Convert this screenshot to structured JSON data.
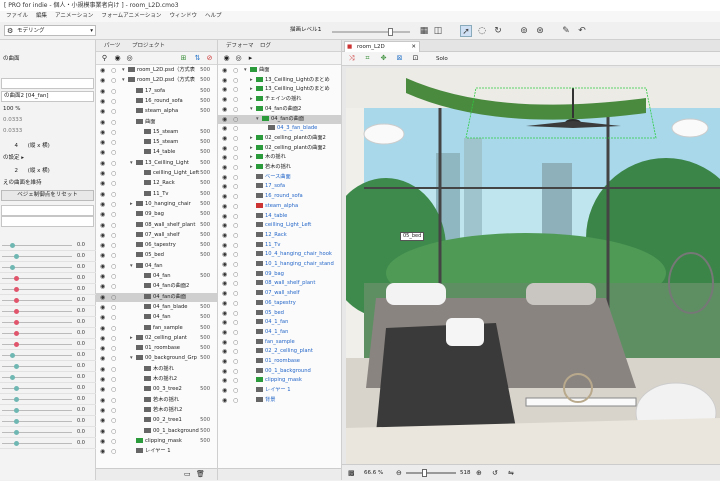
{
  "window": {
    "title": "[ PRO for indie - 個人・小規模事業者向け ] - room_L2D.cmo3"
  },
  "menu": [
    "ファイル",
    "編集",
    "アニメーション",
    "フォームアニメーション",
    "ウィンドウ",
    "ヘルプ"
  ],
  "toolbar": {
    "mode": "モデリング",
    "display_level_label": "描画レベル：",
    "display_level_value": "1"
  },
  "left_panel": {
    "title": "の曲面",
    "part_field": "の曲面2 [04_fan]",
    "opacity": "100 %",
    "val_a": "0.0333",
    "val_b": "0.0333",
    "row_count1": "4",
    "row_count1_suffix": "(縦 x 横)",
    "deform_label": "の設定 ▸",
    "row_count2": "2",
    "row_count2_suffix": "(縦 x 横)",
    "keep_label": "えの曲面を維持",
    "reset_button": "ベジェ制御点をリセット",
    "param_values": [
      "0.0",
      "0.0",
      "0.0",
      "0.0",
      "0.0",
      "0.0",
      "0.0",
      "0.0",
      "0.0",
      "0.0",
      "0.0",
      "0.0",
      "0.0",
      "0.0",
      "0.0",
      "0.0",
      "0.0",
      "0.0",
      "0.0"
    ]
  },
  "parts_panel": {
    "tabs": [
      "パーツ",
      "プロジェクト"
    ],
    "rows": [
      {
        "label": "room_L2D.psd（方式表",
        "num": "500",
        "indent": 0,
        "fold": "▾"
      },
      {
        "label": "room_L2D.psd（方式表",
        "num": "500",
        "indent": 0,
        "fold": "▾"
      },
      {
        "label": "17_sofa",
        "num": "500",
        "indent": 1,
        "fold": ""
      },
      {
        "label": "16_round_sofa",
        "num": "500",
        "indent": 1,
        "fold": ""
      },
      {
        "label": "steam_alpha",
        "num": "500",
        "indent": 1,
        "fold": ""
      },
      {
        "label": "曲面",
        "num": "",
        "indent": 1,
        "fold": ""
      },
      {
        "label": "15_steam",
        "num": "500",
        "indent": 2,
        "fold": ""
      },
      {
        "label": "15_steam",
        "num": "500",
        "indent": 2,
        "fold": ""
      },
      {
        "label": "14_table",
        "num": "500",
        "indent": 2,
        "fold": ""
      },
      {
        "label": "13_Ceilling_Light",
        "num": "500",
        "indent": 1,
        "fold": "▾"
      },
      {
        "label": "ceilling_Light_Left",
        "num": "500",
        "indent": 2,
        "fold": ""
      },
      {
        "label": "12_Rack",
        "num": "500",
        "indent": 2,
        "fold": ""
      },
      {
        "label": "11_Tv",
        "num": "500",
        "indent": 2,
        "fold": ""
      },
      {
        "label": "10_hanging_chair",
        "num": "500",
        "indent": 1,
        "fold": "▸"
      },
      {
        "label": "09_bag",
        "num": "500",
        "indent": 1,
        "fold": ""
      },
      {
        "label": "08_wall_shelf_plant",
        "num": "500",
        "indent": 1,
        "fold": ""
      },
      {
        "label": "07_wall_shelf",
        "num": "500",
        "indent": 1,
        "fold": ""
      },
      {
        "label": "06_tapestry",
        "num": "500",
        "indent": 1,
        "fold": ""
      },
      {
        "label": "05_bed",
        "num": "500",
        "indent": 1,
        "fold": ""
      },
      {
        "label": "04_fan",
        "num": "",
        "indent": 1,
        "fold": "▾"
      },
      {
        "label": "04_fan",
        "num": "500",
        "indent": 2,
        "fold": ""
      },
      {
        "label": "04_fanの曲面2",
        "num": "",
        "indent": 2,
        "fold": ""
      },
      {
        "label": "04_fanの曲面",
        "num": "",
        "indent": 2,
        "fold": "",
        "sel": true
      },
      {
        "label": "04_fan_blade",
        "num": "500",
        "indent": 2,
        "fold": ""
      },
      {
        "label": "04_fan",
        "num": "500",
        "indent": 2,
        "fold": ""
      },
      {
        "label": "fan_sample",
        "num": "500",
        "indent": 2,
        "fold": ""
      },
      {
        "label": "02_celling_plant",
        "num": "500",
        "indent": 1,
        "fold": "▸"
      },
      {
        "label": "01_roombase",
        "num": "500",
        "indent": 1,
        "fold": ""
      },
      {
        "label": "00_background_Grp",
        "num": "500",
        "indent": 1,
        "fold": "▾"
      },
      {
        "label": "木の揺れ",
        "num": "",
        "indent": 2,
        "fold": ""
      },
      {
        "label": "木の揺れ2",
        "num": "",
        "indent": 2,
        "fold": ""
      },
      {
        "label": "00_3_tree2",
        "num": "500",
        "indent": 2,
        "fold": ""
      },
      {
        "label": "若木の揺れ",
        "num": "",
        "indent": 2,
        "fold": ""
      },
      {
        "label": "若木の揺れ2",
        "num": "",
        "indent": 2,
        "fold": ""
      },
      {
        "label": "00_2_tree1",
        "num": "500",
        "indent": 2,
        "fold": ""
      },
      {
        "label": "00_1_background",
        "num": "500",
        "indent": 2,
        "fold": ""
      },
      {
        "label": "clipping_mask",
        "num": "500",
        "indent": 1,
        "fold": ""
      },
      {
        "label": "レイヤー 1",
        "num": "",
        "indent": 1,
        "fold": ""
      }
    ]
  },
  "deformer_panel": {
    "tabs": [
      "デフォーマ",
      "ログ"
    ],
    "rows": [
      {
        "label": "曲面",
        "indent": 0,
        "fold": "▾",
        "blue": false
      },
      {
        "label": "13_Ceilling_Lightのまとめ",
        "indent": 1,
        "fold": "▸",
        "blue": false
      },
      {
        "label": "13_Ceilling_Lightのまとめ",
        "indent": 1,
        "fold": "▸",
        "blue": false
      },
      {
        "label": "チェインの揺れ",
        "indent": 1,
        "fold": "▸",
        "blue": false
      },
      {
        "label": "04_fanの曲面2",
        "indent": 1,
        "fold": "▾",
        "blue": false
      },
      {
        "label": "04_fanの曲面",
        "indent": 2,
        "fold": "▾",
        "blue": false,
        "sel": true
      },
      {
        "label": "04_3_fan_blade",
        "indent": 3,
        "fold": "",
        "blue": true
      },
      {
        "label": "02_celling_plantの曲面2",
        "indent": 1,
        "fold": "▸",
        "blue": false
      },
      {
        "label": "02_celling_plantの曲面2",
        "indent": 1,
        "fold": "▸",
        "blue": false
      },
      {
        "label": "木の揺れ",
        "indent": 1,
        "fold": "▸",
        "blue": false
      },
      {
        "label": "若木の揺れ",
        "indent": 1,
        "fold": "▸",
        "blue": false
      },
      {
        "label": "ベース曲面",
        "indent": 1,
        "fold": "",
        "blue": true
      },
      {
        "label": "17_sofa",
        "indent": 1,
        "fold": "",
        "blue": true
      },
      {
        "label": "16_round_sofa",
        "indent": 1,
        "fold": "",
        "blue": true
      },
      {
        "label": "steam_alpha",
        "indent": 1,
        "fold": "",
        "blue": true
      },
      {
        "label": "14_table",
        "indent": 1,
        "fold": "",
        "blue": true
      },
      {
        "label": "ceilling_Light_Left",
        "indent": 1,
        "fold": "",
        "blue": true
      },
      {
        "label": "12_Rack",
        "indent": 1,
        "fold": "",
        "blue": true
      },
      {
        "label": "11_Tv",
        "indent": 1,
        "fold": "",
        "blue": true
      },
      {
        "label": "10_4_hanging_chair_hook",
        "indent": 1,
        "fold": "",
        "blue": true
      },
      {
        "label": "10_1_hanging_chair_stand",
        "indent": 1,
        "fold": "",
        "blue": true
      },
      {
        "label": "09_bag",
        "indent": 1,
        "fold": "",
        "blue": true
      },
      {
        "label": "08_wall_shelf_plant",
        "indent": 1,
        "fold": "",
        "blue": true
      },
      {
        "label": "07_wall_shelf",
        "indent": 1,
        "fold": "",
        "blue": true
      },
      {
        "label": "06_tapestry",
        "indent": 1,
        "fold": "",
        "blue": true
      },
      {
        "label": "05_bed",
        "indent": 1,
        "fold": "",
        "blue": true
      },
      {
        "label": "04_1_fan",
        "indent": 1,
        "fold": "",
        "blue": true
      },
      {
        "label": "04_1_fan",
        "indent": 1,
        "fold": "",
        "blue": true
      },
      {
        "label": "fan_sample",
        "indent": 1,
        "fold": "",
        "blue": true
      },
      {
        "label": "02_2_celling_plant",
        "indent": 1,
        "fold": "",
        "blue": true
      },
      {
        "label": "01_roombase",
        "indent": 1,
        "fold": "",
        "blue": true
      },
      {
        "label": "00_1_background",
        "indent": 1,
        "fold": "",
        "blue": true
      },
      {
        "label": "clipping_mask",
        "indent": 1,
        "fold": "",
        "blue": true
      },
      {
        "label": "レイヤー 1",
        "indent": 1,
        "fold": "",
        "blue": true
      },
      {
        "label": "背景",
        "indent": 1,
        "fold": "",
        "blue": true
      }
    ]
  },
  "canvas": {
    "tab": "room_L2D",
    "solo": "Solo",
    "selected_marker": "05_bed",
    "zoom": "66.6 %",
    "zoom_value": "518"
  }
}
